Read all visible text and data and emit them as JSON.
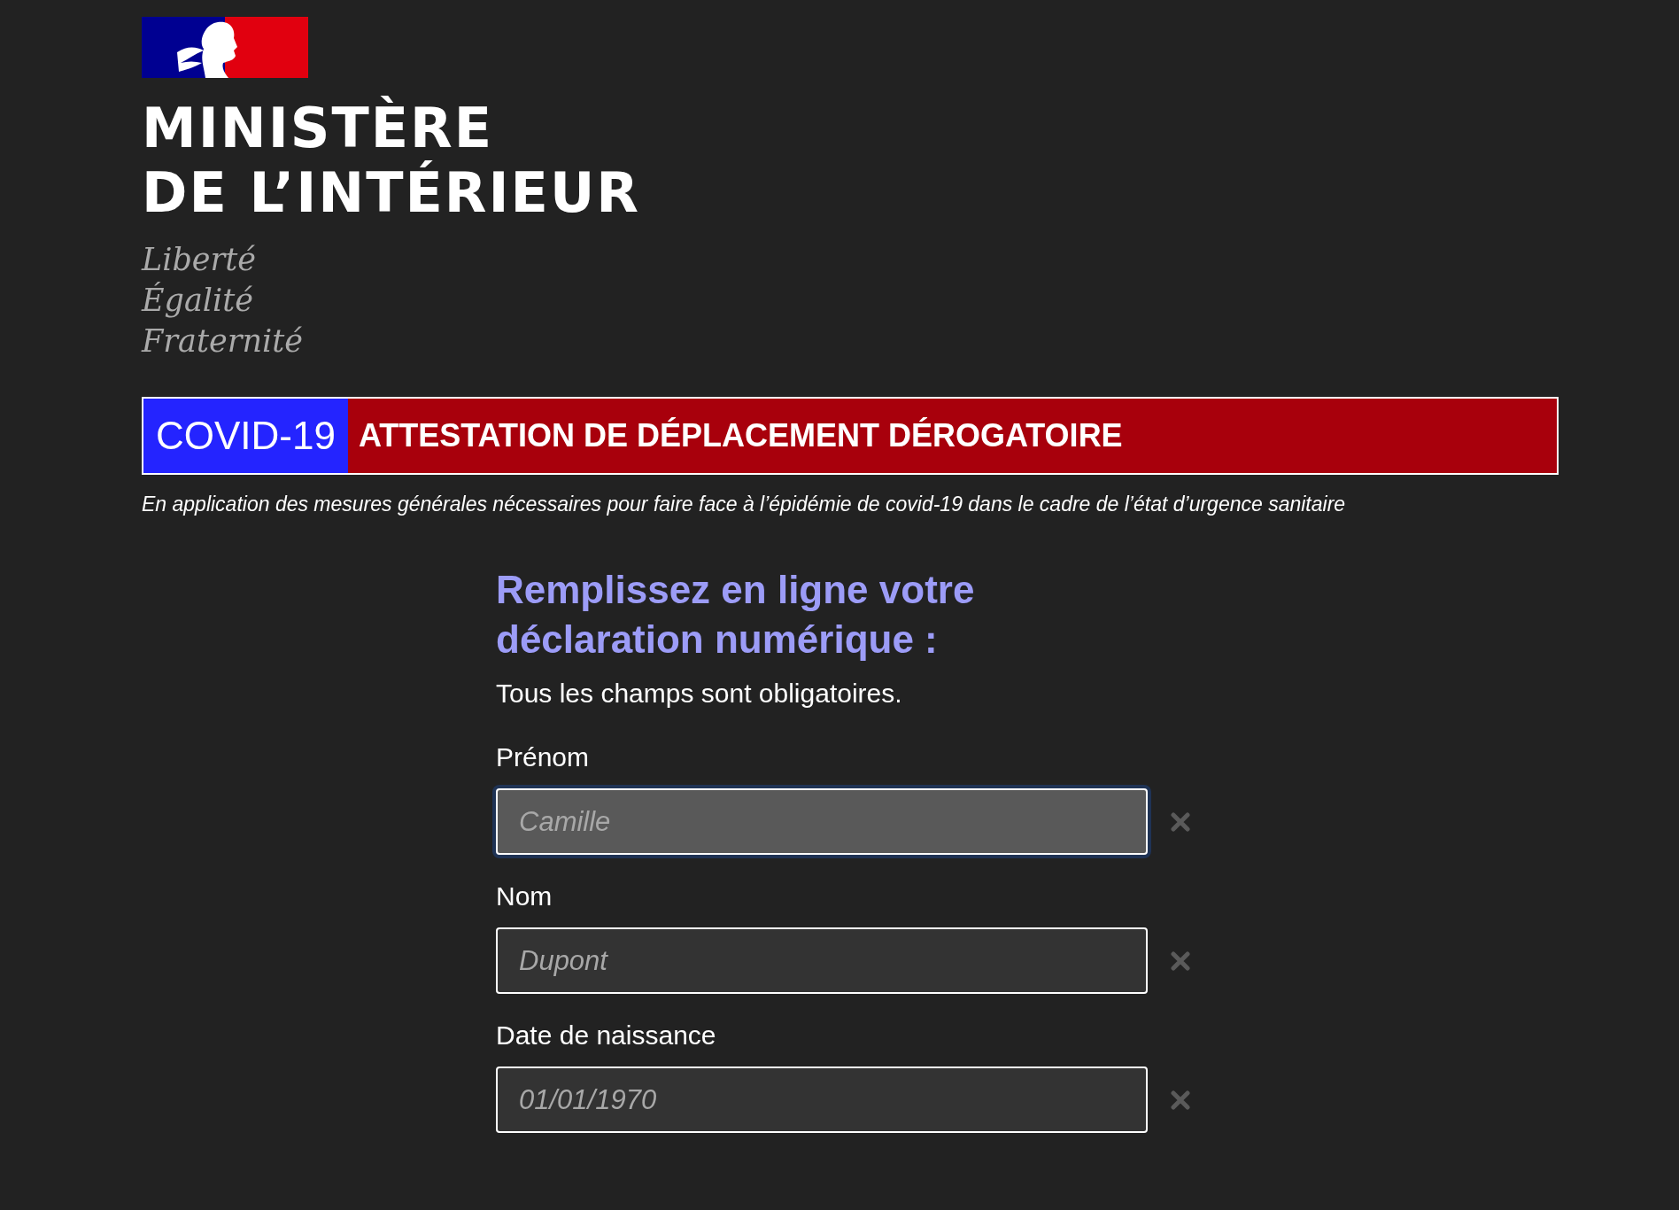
{
  "header": {
    "ministry_lines": [
      "MINISTÈRE",
      "DE L’INTÉRIEUR"
    ],
    "motto": [
      "Liberté",
      "Égalité",
      "Fraternité"
    ]
  },
  "banner": {
    "tag": "COVID-19",
    "title": "ATTESTATION DE DÉPLACEMENT DÉROGATOIRE"
  },
  "subtitle": "En application des mesures générales nécessaires pour faire face à l’épidémie de covid-19 dans le cadre de l’état d’urgence sanitaire",
  "form": {
    "heading": "Remplissez en ligne votre déclaration numérique :",
    "note": "Tous les champs sont obligatoires.",
    "fields": [
      {
        "label": "Prénom",
        "placeholder": "Camille",
        "focused": true
      },
      {
        "label": "Nom",
        "placeholder": "Dupont",
        "focused": false
      },
      {
        "label": "Date de naissance",
        "placeholder": "01/01/1970",
        "focused": false
      }
    ]
  }
}
